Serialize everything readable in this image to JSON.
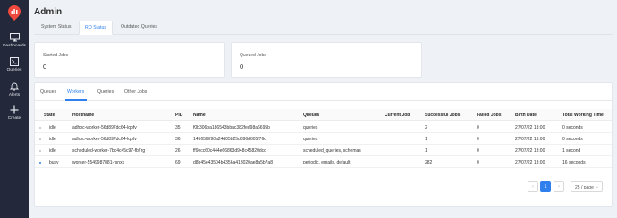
{
  "sidebar": {
    "items": [
      {
        "label": "Dashboards",
        "icon": "desktop-icon"
      },
      {
        "label": "Queries",
        "icon": "terminal-icon"
      },
      {
        "label": "Alerts",
        "icon": "bell-icon"
      },
      {
        "label": "Create",
        "icon": "plus-icon"
      }
    ]
  },
  "page": {
    "title": "Admin"
  },
  "top_tabs": [
    "System Status",
    "RQ Status",
    "Outdated Queries"
  ],
  "cards": [
    {
      "title": "Started Jobs",
      "value": "0"
    },
    {
      "title": "Queued Jobs",
      "value": "0"
    }
  ],
  "sub_tabs": [
    "Queues",
    "Workers",
    "Queries",
    "Other Jobs"
  ],
  "table": {
    "columns": [
      "State",
      "Hostname",
      "PID",
      "Name",
      "Queues",
      "Current Job",
      "Successful Jobs",
      "Failed Jobs",
      "Birth Date",
      "Total Working Time"
    ],
    "rows": [
      {
        "state": "idle",
        "hostname": "adhoc-worker-56d897dc64-lqbfv",
        "pid": "35",
        "name": "f0b306ba186543bbac382fed98a6695b",
        "queues": "queries",
        "current_job": "",
        "successful": "2",
        "failed": "0",
        "birth": "27/07/22 13:00",
        "working": "0 seconds"
      },
      {
        "state": "idle",
        "hostname": "adhoc-worker-56d897dc64-lqbfv",
        "pid": "36",
        "name": "14565f9f90a24d05b25d396d605f76c",
        "queues": "queries",
        "current_job": "",
        "successful": "1",
        "failed": "0",
        "birth": "27/07/22 13:00",
        "working": "0 seconds"
      },
      {
        "state": "idle",
        "hostname": "scheduled-worker-7bc4c45c97-fb7rg",
        "pid": "26",
        "name": "ff9ecc60c444e66863d948c45820dcd",
        "queues": "scheduled_queries, schemas",
        "current_job": "",
        "successful": "1",
        "failed": "0",
        "birth": "27/07/22 13:00",
        "working": "1 second"
      },
      {
        "state": "busy",
        "hostname": "worker-5549987881-rsnxk",
        "pid": "69",
        "name": "d8b45e43504b4356a413020ae8a5b7a8",
        "queues": "periodic, emails, default",
        "current_job": "",
        "successful": "282",
        "failed": "0",
        "birth": "27/07/22 13:00",
        "working": "16 seconds"
      }
    ]
  },
  "pagination": {
    "prev": "‹",
    "page": "1",
    "next": "›",
    "page_size": "25 / page"
  },
  "colors": {
    "accent": "#2f80ed",
    "sidebar": "#23283a",
    "logo": "#f0493d"
  }
}
